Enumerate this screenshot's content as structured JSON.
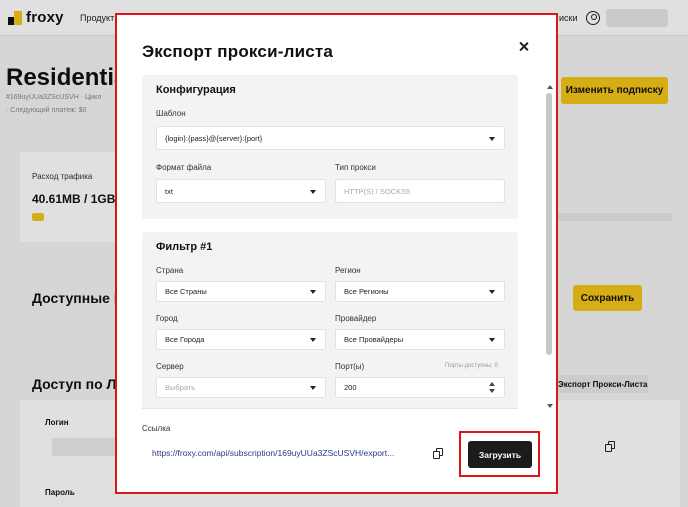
{
  "background": {
    "logo_text": "froxy",
    "nav_product": "Продукт",
    "nav_right": "иски",
    "title": "Residentia",
    "subscription_line": "#169uyUUa3ZScUSVH  ·  Цикл",
    "next_payment": "· Следующий платеж: $0",
    "change_subscription": "Изменить подписку",
    "traffic_label": "Расход трафика",
    "traffic_value": "40.61MB / 1GB",
    "traffic_fraction": 0.04,
    "available_heading": "Доступные I",
    "save_label": "Сохранить",
    "access_heading": "Доступ по Ло",
    "export_tab": "Экспорт Прокси-Листа",
    "login_label": "Логин",
    "password_label": "Пароль"
  },
  "modal": {
    "title": "Экспорт прокси-листа",
    "config": {
      "title": "Конфигурация",
      "template_label": "Шаблон",
      "template_value": "{login}:{pass}@{server}:{port}",
      "file_format_label": "Формат файла",
      "file_format_value": "txt",
      "proxy_type_label": "Тип прокси",
      "proxy_type_value": "HTTP(S) / SOCKS5"
    },
    "filter": {
      "title": "Фильтр #1",
      "country_label": "Страна",
      "country_value": "Все Страны",
      "region_label": "Регион",
      "region_value": "Все Регионы",
      "city_label": "Город",
      "city_value": "Все Города",
      "provider_label": "Провайдер",
      "provider_value": "Все Провайдеры",
      "server_label": "Сервер",
      "server_placeholder": "Выбрать",
      "ports_label": "Порт(ы)",
      "ports_available": "Порты доступны: 0",
      "ports_value": "200"
    },
    "link_label": "Ссылка",
    "link_url": "https://froxy.com/api/subscription/169uyUUa3ZScUSVH/export...",
    "download_label": "Загрузить"
  },
  "colors": {
    "accent": "#f5c518",
    "highlight_outline": "#d9161c",
    "link": "#2a3a8c",
    "primary_button": "#1b1b1b"
  }
}
